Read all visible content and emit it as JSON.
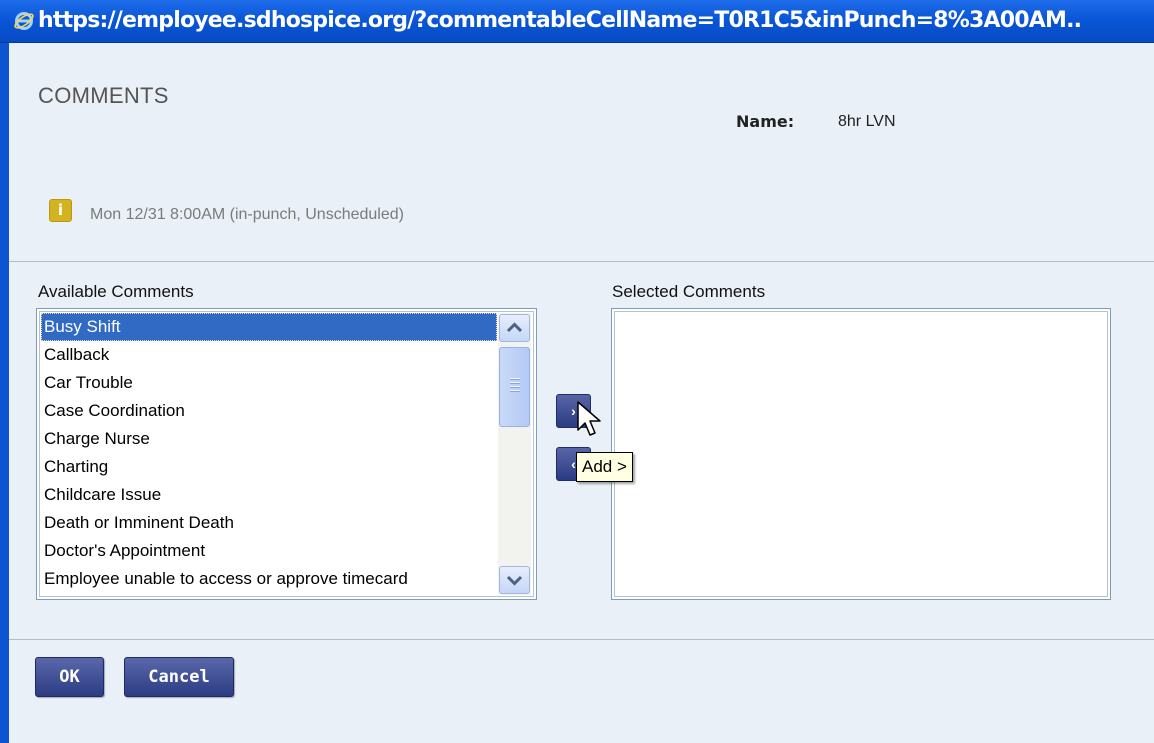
{
  "window": {
    "title_url": "https://employee.sdhospice.org/?commentableCellName=T0R1C5&inPunch=8%3A00AM.."
  },
  "header": {
    "heading": "COMMENTS",
    "name_label": "Name:",
    "name_value": "8hr LVN"
  },
  "info": {
    "icon": "info-icon",
    "icon_glyph": "i",
    "punch_text": "Mon 12/31  8:00AM  (in-punch, Unscheduled)"
  },
  "available": {
    "label": "Available Comments",
    "items": [
      "Busy Shift",
      "Callback",
      "Car Trouble",
      "Case Coordination",
      "Charge Nurse",
      "Charting",
      "Childcare Issue",
      "Death or Imminent Death",
      "Doctor's Appointment",
      "Employee unable to access or approve timecard"
    ],
    "selected_index": 0
  },
  "selected": {
    "label": "Selected Comments",
    "items": []
  },
  "movers": {
    "add_glyph": "›",
    "remove_glyph": "‹",
    "tooltip": "Add >"
  },
  "actions": {
    "ok_label": "OK",
    "cancel_label": "Cancel"
  },
  "colors": {
    "titlebar": "#0a56d8",
    "selection": "#316ac5",
    "button": "#2c3c84",
    "info_badge": "#d4b320",
    "tooltip_bg": "#ffffe1"
  }
}
